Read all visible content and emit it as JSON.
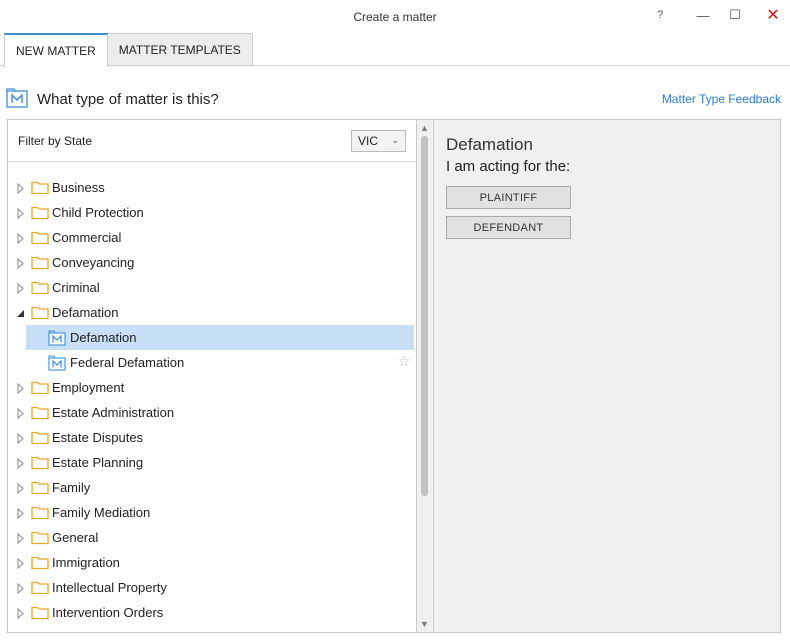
{
  "window": {
    "title": "Create a matter",
    "help": "?",
    "minimize": "—",
    "maximize": "☐",
    "close": "✕"
  },
  "tabs": [
    {
      "label": "NEW MATTER",
      "active": true
    },
    {
      "label": "MATTER TEMPLATES",
      "active": false
    }
  ],
  "header": {
    "question": "What type of matter is this?",
    "feedback_link": "Matter Type Feedback"
  },
  "filter": {
    "label": "Filter by State",
    "selected_state": "VIC"
  },
  "tree": [
    {
      "label": "Business",
      "expanded": false
    },
    {
      "label": "Child Protection",
      "expanded": false
    },
    {
      "label": "Commercial",
      "expanded": false
    },
    {
      "label": "Conveyancing",
      "expanded": false
    },
    {
      "label": "Criminal",
      "expanded": false
    },
    {
      "label": "Defamation",
      "expanded": true,
      "children": [
        {
          "label": "Defamation",
          "selected": true
        },
        {
          "label": "Federal Defamation",
          "selected": false
        }
      ]
    },
    {
      "label": "Employment",
      "expanded": false
    },
    {
      "label": "Estate Administration",
      "expanded": false
    },
    {
      "label": "Estate Disputes",
      "expanded": false
    },
    {
      "label": "Estate Planning",
      "expanded": false
    },
    {
      "label": "Family",
      "expanded": false
    },
    {
      "label": "Family Mediation",
      "expanded": false
    },
    {
      "label": "General",
      "expanded": false
    },
    {
      "label": "Immigration",
      "expanded": false
    },
    {
      "label": "Intellectual Property",
      "expanded": false
    },
    {
      "label": "Intervention Orders",
      "expanded": false
    }
  ],
  "detail": {
    "title": "Defamation",
    "subtitle": "I am acting for the:",
    "buttons": [
      "PLAINTIFF",
      "DEFENDANT"
    ]
  },
  "colors": {
    "accent": "#3a8fd6",
    "link": "#2b7cd3",
    "selection": "#c7dff7",
    "folder": "#e8a828",
    "close": "#dd1111"
  },
  "icons": {
    "folder": "folder-icon",
    "matter": "matter-type-icon",
    "expand": "expand-arrow-icon",
    "collapse": "collapse-arrow-icon",
    "favorite": "star-icon"
  }
}
